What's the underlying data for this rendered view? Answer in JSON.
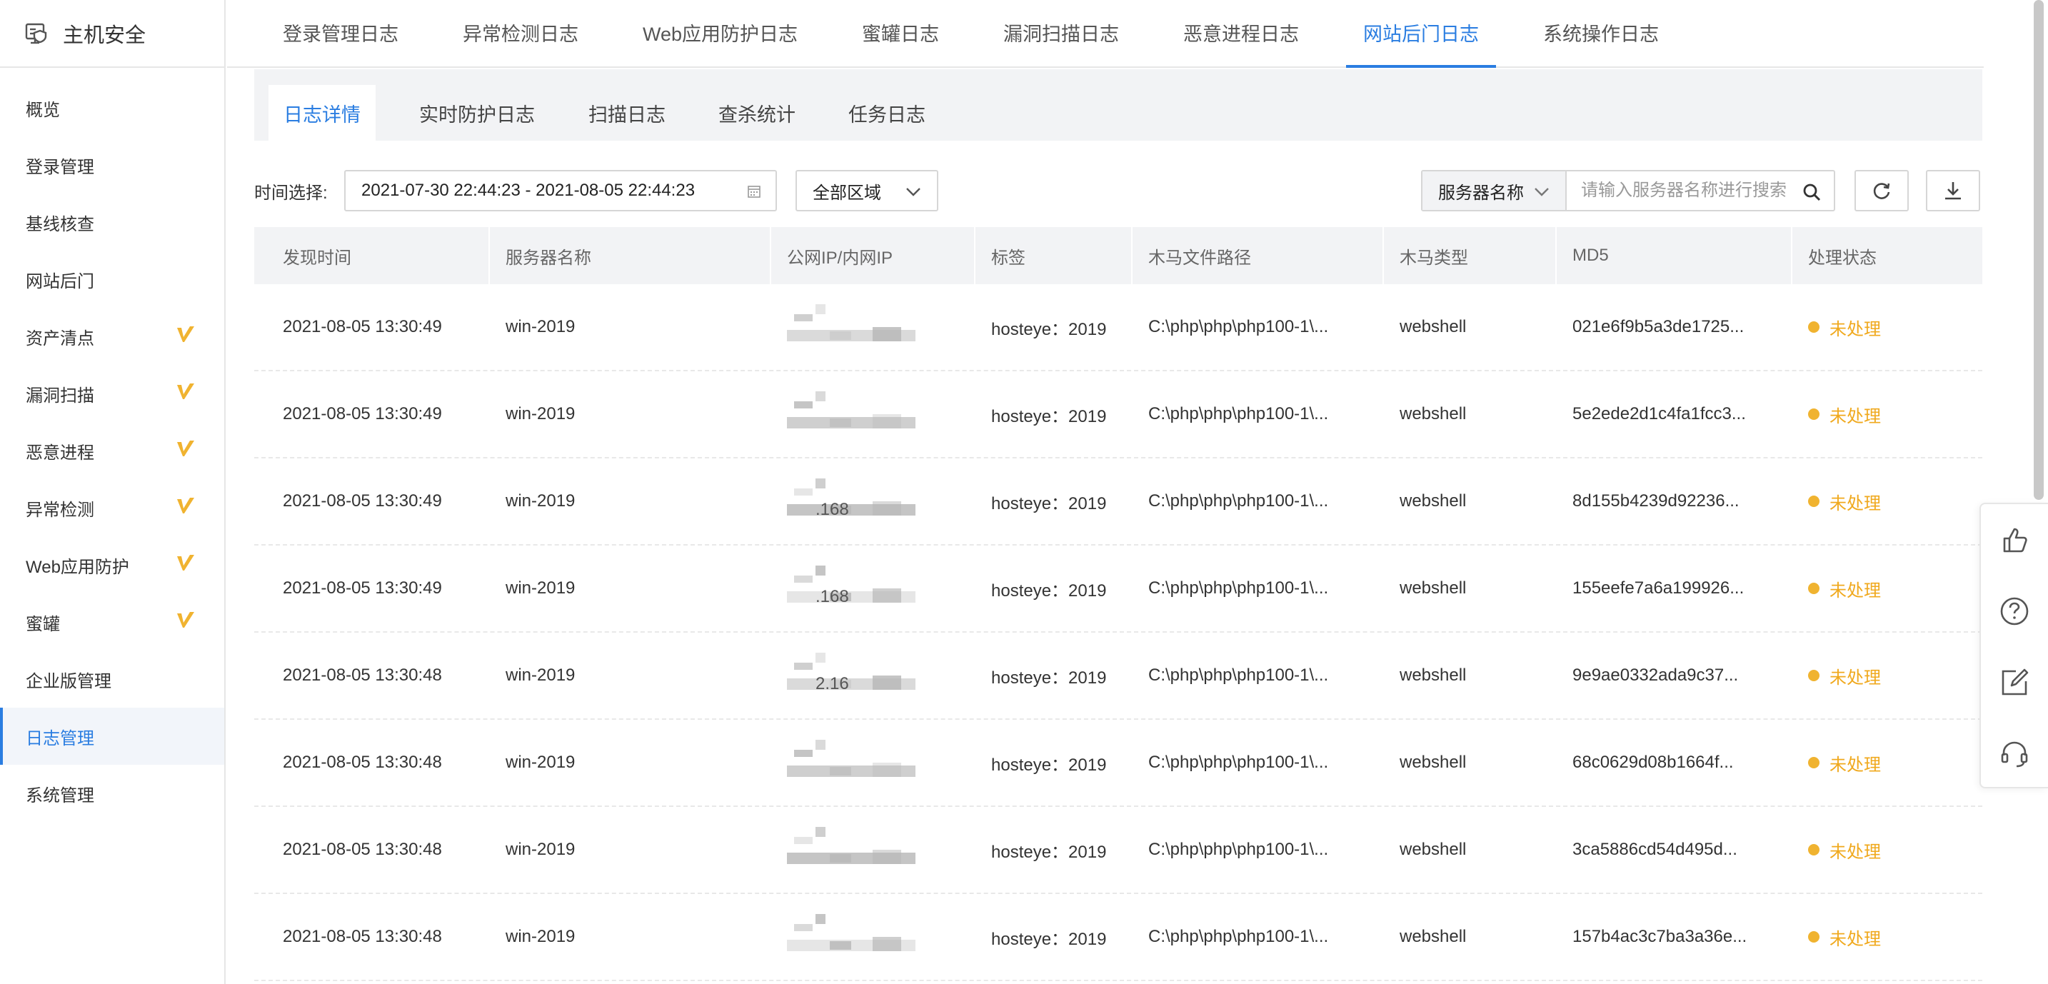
{
  "sidebar": {
    "title": "主机安全",
    "items": [
      {
        "label": "概览",
        "marked": false,
        "active": false
      },
      {
        "label": "登录管理",
        "marked": false,
        "active": false
      },
      {
        "label": "基线核查",
        "marked": false,
        "active": false
      },
      {
        "label": "网站后门",
        "marked": false,
        "active": false
      },
      {
        "label": "资产清点",
        "marked": true,
        "active": false
      },
      {
        "label": "漏洞扫描",
        "marked": true,
        "active": false
      },
      {
        "label": "恶意进程",
        "marked": true,
        "active": false
      },
      {
        "label": "异常检测",
        "marked": true,
        "active": false
      },
      {
        "label": "Web应用防护",
        "marked": true,
        "active": false
      },
      {
        "label": "蜜罐",
        "marked": true,
        "active": false
      },
      {
        "label": "企业版管理",
        "marked": false,
        "active": false
      },
      {
        "label": "日志管理",
        "marked": false,
        "active": true
      },
      {
        "label": "系统管理",
        "marked": false,
        "active": false
      }
    ]
  },
  "top_tabs": [
    {
      "label": "登录管理日志",
      "active": false
    },
    {
      "label": "异常检测日志",
      "active": false
    },
    {
      "label": "Web应用防护日志",
      "active": false
    },
    {
      "label": "蜜罐日志",
      "active": false
    },
    {
      "label": "漏洞扫描日志",
      "active": false
    },
    {
      "label": "恶意进程日志",
      "active": false
    },
    {
      "label": "网站后门日志",
      "active": true
    },
    {
      "label": "系统操作日志",
      "active": false
    }
  ],
  "sub_tabs": [
    {
      "label": "日志详情",
      "active": true
    },
    {
      "label": "实时防护日志",
      "active": false
    },
    {
      "label": "扫描日志",
      "active": false
    },
    {
      "label": "查杀统计",
      "active": false
    },
    {
      "label": "任务日志",
      "active": false
    }
  ],
  "filters": {
    "time_label": "时间选择:",
    "date_range": "2021-07-30 22:44:23 - 2021-08-05 22:44:23",
    "region": "全部区域",
    "search_field": "服务器名称",
    "search_placeholder": "请输入服务器名称进行搜索"
  },
  "table": {
    "columns": [
      "发现时间",
      "服务器名称",
      "公网IP/内网IP",
      "标签",
      "木马文件路径",
      "木马类型",
      "MD5",
      "处理状态"
    ],
    "rows": [
      {
        "time": "2021-08-05 13:30:49",
        "server": "win-2019",
        "ip_hint": "",
        "tag": "hosteye：2019",
        "path": "C:\\php\\php\\php100-1\\...",
        "type": "webshell",
        "md5": "021e6f9b5a3de1725...",
        "status": "未处理"
      },
      {
        "time": "2021-08-05 13:30:49",
        "server": "win-2019",
        "ip_hint": "",
        "tag": "hosteye：2019",
        "path": "C:\\php\\php\\php100-1\\...",
        "type": "webshell",
        "md5": "5e2ede2d1c4fa1fcc3...",
        "status": "未处理"
      },
      {
        "time": "2021-08-05 13:30:49",
        "server": "win-2019",
        "ip_hint": ".168",
        "tag": "hosteye：2019",
        "path": "C:\\php\\php\\php100-1\\...",
        "type": "webshell",
        "md5": "8d155b4239d92236...",
        "status": "未处理"
      },
      {
        "time": "2021-08-05 13:30:49",
        "server": "win-2019",
        "ip_hint": ".168",
        "tag": "hosteye：2019",
        "path": "C:\\php\\php\\php100-1\\...",
        "type": "webshell",
        "md5": "155eefe7a6a199926...",
        "status": "未处理"
      },
      {
        "time": "2021-08-05 13:30:48",
        "server": "win-2019",
        "ip_hint": "2.16",
        "tag": "hosteye：2019",
        "path": "C:\\php\\php\\php100-1\\...",
        "type": "webshell",
        "md5": "9e9ae0332ada9c37...",
        "status": "未处理"
      },
      {
        "time": "2021-08-05 13:30:48",
        "server": "win-2019",
        "ip_hint": "",
        "tag": "hosteye：2019",
        "path": "C:\\php\\php\\php100-1\\...",
        "type": "webshell",
        "md5": "68c0629d08b1664f...",
        "status": "未处理"
      },
      {
        "time": "2021-08-05 13:30:48",
        "server": "win-2019",
        "ip_hint": "",
        "tag": "hosteye：2019",
        "path": "C:\\php\\php\\php100-1\\...",
        "type": "webshell",
        "md5": "3ca5886cd54d495d...",
        "status": "未处理"
      },
      {
        "time": "2021-08-05 13:30:48",
        "server": "win-2019",
        "ip_hint": "",
        "tag": "hosteye：2019",
        "path": "C:\\php\\php\\php100-1\\...",
        "type": "webshell",
        "md5": "157b4ac3c7ba3a36e...",
        "status": "未处理"
      }
    ]
  },
  "float_bar": [
    "thumbs-up-icon",
    "help-icon",
    "edit-icon",
    "headset-icon"
  ],
  "colors": {
    "accent": "#2a7de1",
    "pending": "#f0a91e",
    "mark": "#f0b330"
  }
}
